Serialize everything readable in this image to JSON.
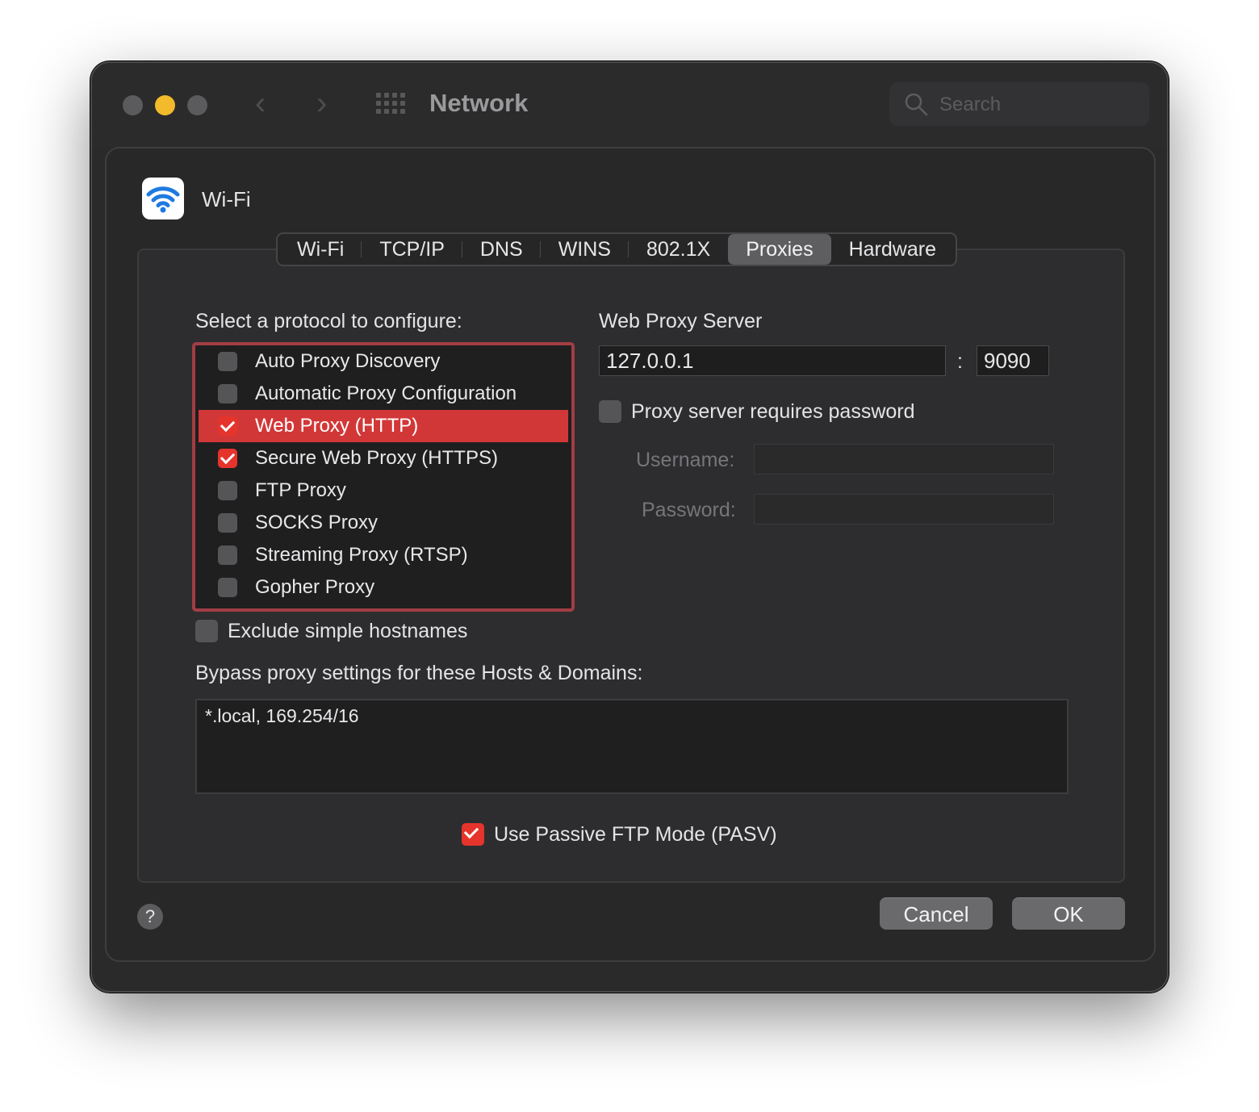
{
  "window": {
    "title": "Network"
  },
  "search": {
    "placeholder": "Search"
  },
  "sheet": {
    "title": "Wi-Fi",
    "tabs": [
      {
        "label": "Wi-Fi"
      },
      {
        "label": "TCP/IP"
      },
      {
        "label": "DNS"
      },
      {
        "label": "WINS"
      },
      {
        "label": "802.1X"
      },
      {
        "label": "Proxies",
        "active": true
      },
      {
        "label": "Hardware"
      }
    ]
  },
  "proxies": {
    "select_label": "Select a protocol to configure:",
    "protocols": [
      {
        "label": "Auto Proxy Discovery",
        "checked": false,
        "selected": false
      },
      {
        "label": "Automatic Proxy Configuration",
        "checked": false,
        "selected": false
      },
      {
        "label": "Web Proxy (HTTP)",
        "checked": true,
        "selected": true
      },
      {
        "label": "Secure Web Proxy (HTTPS)",
        "checked": true,
        "selected": false
      },
      {
        "label": "FTP Proxy",
        "checked": false,
        "selected": false
      },
      {
        "label": "SOCKS Proxy",
        "checked": false,
        "selected": false
      },
      {
        "label": "Streaming Proxy (RTSP)",
        "checked": false,
        "selected": false
      },
      {
        "label": "Gopher Proxy",
        "checked": false,
        "selected": false
      }
    ],
    "server_label": "Web Proxy Server",
    "server_host": "127.0.0.1",
    "colon": ":",
    "server_port": "9090",
    "requires_password_label": "Proxy server requires password",
    "requires_password": false,
    "username_label": "Username:",
    "password_label": "Password:",
    "exclude_simple_label": "Exclude simple hostnames",
    "exclude_simple": false,
    "bypass_label": "Bypass proxy settings for these Hosts & Domains:",
    "bypass_value": "*.local, 169.254/16",
    "pasv_label": "Use Passive FTP Mode (PASV)",
    "pasv": true
  },
  "buttons": {
    "help": "?",
    "cancel": "Cancel",
    "ok": "OK"
  },
  "colors": {
    "accent": "#e5342c",
    "selection": "#d23737",
    "focus_ring": "#a23d44"
  }
}
